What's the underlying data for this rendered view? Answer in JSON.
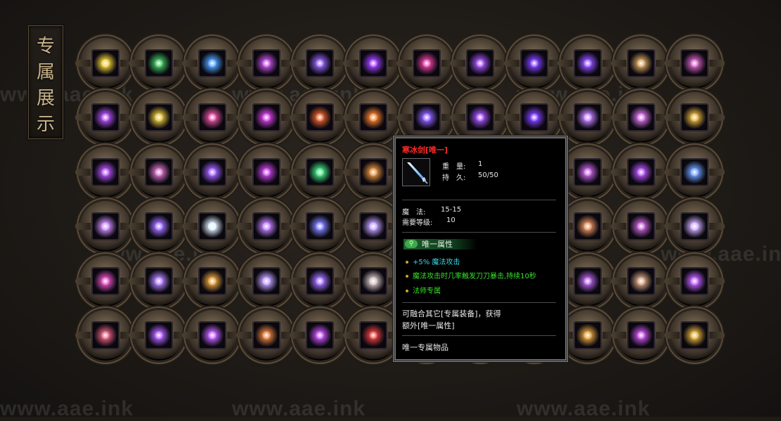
{
  "title": {
    "chars": [
      "专",
      "属",
      "展",
      "示"
    ]
  },
  "watermark": "www.aae.ink",
  "grid": {
    "rows": 6,
    "cols": 12,
    "items": [
      {
        "color": "#f0d040"
      },
      {
        "color": "#40c060"
      },
      {
        "color": "#50a0ff"
      },
      {
        "color": "#c050e0"
      },
      {
        "color": "#9060f0"
      },
      {
        "color": "#a040ff"
      },
      {
        "color": "#e040a0"
      },
      {
        "color": "#a050f0"
      },
      {
        "color": "#8040ff"
      },
      {
        "color": "#9050ff"
      },
      {
        "color": "#d0a060"
      },
      {
        "color": "#d060c0"
      },
      {
        "color": "#b050f0"
      },
      {
        "color": "#e0c040"
      },
      {
        "color": "#e050a0"
      },
      {
        "color": "#d040e0"
      },
      {
        "color": "#e06030"
      },
      {
        "color": "#f08030"
      },
      {
        "color": "#9060ff"
      },
      {
        "color": "#a050f0"
      },
      {
        "color": "#8040ff"
      },
      {
        "color": "#c080ff"
      },
      {
        "color": "#d070e0"
      },
      {
        "color": "#e0b040"
      },
      {
        "color": "#b050f0"
      },
      {
        "color": "#d070c0"
      },
      {
        "color": "#a060ff"
      },
      {
        "color": "#c040e0"
      },
      {
        "color": "#40e080"
      },
      {
        "color": "#e09040"
      },
      {
        "color": "#9050ff"
      },
      {
        "color": "#9050ff"
      },
      {
        "color": "#9050ff"
      },
      {
        "color": "#c060e0"
      },
      {
        "color": "#b050f0"
      },
      {
        "color": "#70a0ff"
      },
      {
        "color": "#d090ff"
      },
      {
        "color": "#a070ff"
      },
      {
        "color": "#e0f0ff"
      },
      {
        "color": "#c080ff"
      },
      {
        "color": "#8080ff"
      },
      {
        "color": "#c0a0ff"
      },
      {
        "color": "#9050ff"
      },
      {
        "color": "#9050ff"
      },
      {
        "color": "#9050ff"
      },
      {
        "color": "#e09060"
      },
      {
        "color": "#c060d0"
      },
      {
        "color": "#d0b0ff"
      },
      {
        "color": "#e050c0"
      },
      {
        "color": "#b080ff"
      },
      {
        "color": "#e0a040"
      },
      {
        "color": "#c0a0ff"
      },
      {
        "color": "#a070ff"
      },
      {
        "color": "#d0c0c0"
      },
      {
        "color": "#9050ff"
      },
      {
        "color": "#9050ff"
      },
      {
        "color": "#9050ff"
      },
      {
        "color": "#b060e0"
      },
      {
        "color": "#d0a080"
      },
      {
        "color": "#c060ff"
      },
      {
        "color": "#e06080"
      },
      {
        "color": "#b060ff"
      },
      {
        "color": "#c060ff"
      },
      {
        "color": "#e08040"
      },
      {
        "color": "#c050f0"
      },
      {
        "color": "#e04040"
      },
      {
        "color": "#9050ff"
      },
      {
        "color": "#9050ff"
      },
      {
        "color": "#9050ff"
      },
      {
        "color": "#e0a040"
      },
      {
        "color": "#c050e0"
      },
      {
        "color": "#e0b040"
      }
    ]
  },
  "tooltip": {
    "item_name": "寒冰剑[唯一]",
    "weight_label": "重　量:",
    "weight_value": "1",
    "durability_label": "持　久:",
    "durability_value": "50/50",
    "magic_label": "魔　法:",
    "magic_value": "15-15",
    "level_label": "需要等级:",
    "level_value": "10",
    "badge": "唯一属性",
    "attributes": [
      {
        "text": "+5% 魔法攻击",
        "color": "cyan"
      },
      {
        "text": "魔法攻击时几率触发刀刀暴击,持续10秒",
        "color": "green"
      },
      {
        "text": "法师专属",
        "color": "green"
      }
    ],
    "merge_line1": "可融合其它[专属装备]，获得",
    "merge_line2": "额外[唯一属性]",
    "footer": "唯一专属物品"
  }
}
